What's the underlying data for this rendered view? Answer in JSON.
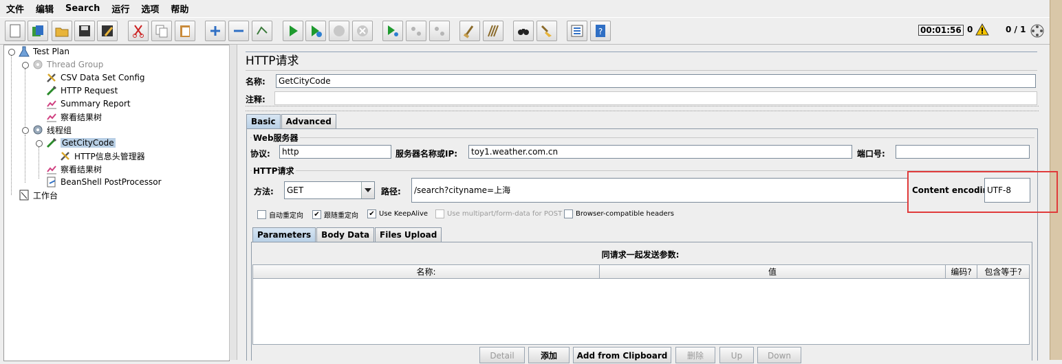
{
  "menu": [
    "文件",
    "编辑",
    "Search",
    "运行",
    "选项",
    "帮助"
  ],
  "toolbar": {
    "buttons": [
      "new-icon",
      "templates-icon",
      "open-icon",
      "save-icon",
      "save-as-icon",
      "cut-icon",
      "copy-icon",
      "paste-icon",
      "expand-icon",
      "collapse-icon",
      "toggle-icon",
      "start-icon",
      "start-no-pause-icon",
      "stop-icon",
      "shutdown-icon",
      "remote-start-icon",
      "remote-stop-icon",
      "remote-shutdown-icon",
      "clear-icon",
      "clear-all-icon",
      "search-icon",
      "reset-search-icon",
      "function-helper-icon",
      "help-icon"
    ],
    "timer": "00:01:56",
    "warnings": "0",
    "threads": "0 / 1"
  },
  "tree": {
    "test_plan": "Test Plan",
    "thread_group": "Thread Group",
    "csv": "CSV Data Set Config",
    "http_request": "HTTP Request",
    "summary": "Summary Report",
    "view_results_1": "察看结果树",
    "thread_group_cn": "线程组",
    "get_city_code": "GetCityCode",
    "header_manager": "HTTP信息头管理器",
    "view_results_2": "察看结果树",
    "beanshell": "BeanShell PostProcessor",
    "workbench": "工作台"
  },
  "panel": {
    "title": "HTTP请求",
    "name_label": "名称:",
    "name_value": "GetCityCode",
    "comment_label": "注释:",
    "comment_value": "",
    "tabs": [
      "Basic",
      "Advanced"
    ],
    "web_server_title": "Web服务器",
    "protocol_label": "协议:",
    "protocol_value": "http",
    "server_label": "服务器名称或IP:",
    "server_value": "toy1.weather.com.cn",
    "port_label": "端口号:",
    "port_value": "",
    "http_request_title": "HTTP请求",
    "method_label": "方法:",
    "method_value": "GET",
    "path_label": "路径:",
    "path_value": "/search?cityname=上海",
    "encoding_label": "Content encoding:",
    "encoding_value": "UTF-8",
    "checkboxes": [
      {
        "label": "自动重定向",
        "checked": false,
        "disabled": false
      },
      {
        "label": "跟随重定向",
        "checked": true,
        "disabled": false
      },
      {
        "label": "Use KeepAlive",
        "checked": true,
        "disabled": false
      },
      {
        "label": "Use multipart/form-data for POST",
        "checked": false,
        "disabled": true
      },
      {
        "label": "Browser-compatible headers",
        "checked": false,
        "disabled": false
      }
    ],
    "subtabs": [
      "Parameters",
      "Body Data",
      "Files Upload"
    ],
    "params_title": "同请求一起发送参数:",
    "columns": [
      "名称:",
      "值",
      "编码?",
      "包含等于?"
    ],
    "buttons": [
      "Detail",
      "添加",
      "Add from Clipboard",
      "删除",
      "Up",
      "Down"
    ]
  },
  "colors": {
    "highlight": "#e03a3a",
    "selection": "#b8cfe5"
  }
}
